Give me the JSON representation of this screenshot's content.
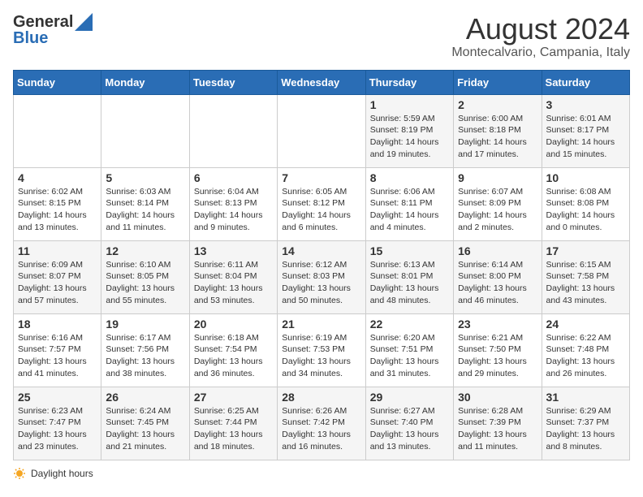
{
  "header": {
    "logo_general": "General",
    "logo_blue": "Blue",
    "title": "August 2024",
    "subtitle": "Montecalvario, Campania, Italy"
  },
  "calendar": {
    "days_of_week": [
      "Sunday",
      "Monday",
      "Tuesday",
      "Wednesday",
      "Thursday",
      "Friday",
      "Saturday"
    ],
    "weeks": [
      [
        {
          "day": "",
          "info": ""
        },
        {
          "day": "",
          "info": ""
        },
        {
          "day": "",
          "info": ""
        },
        {
          "day": "",
          "info": ""
        },
        {
          "day": "1",
          "info": "Sunrise: 5:59 AM\nSunset: 8:19 PM\nDaylight: 14 hours and 19 minutes."
        },
        {
          "day": "2",
          "info": "Sunrise: 6:00 AM\nSunset: 8:18 PM\nDaylight: 14 hours and 17 minutes."
        },
        {
          "day": "3",
          "info": "Sunrise: 6:01 AM\nSunset: 8:17 PM\nDaylight: 14 hours and 15 minutes."
        }
      ],
      [
        {
          "day": "4",
          "info": "Sunrise: 6:02 AM\nSunset: 8:15 PM\nDaylight: 14 hours and 13 minutes."
        },
        {
          "day": "5",
          "info": "Sunrise: 6:03 AM\nSunset: 8:14 PM\nDaylight: 14 hours and 11 minutes."
        },
        {
          "day": "6",
          "info": "Sunrise: 6:04 AM\nSunset: 8:13 PM\nDaylight: 14 hours and 9 minutes."
        },
        {
          "day": "7",
          "info": "Sunrise: 6:05 AM\nSunset: 8:12 PM\nDaylight: 14 hours and 6 minutes."
        },
        {
          "day": "8",
          "info": "Sunrise: 6:06 AM\nSunset: 8:11 PM\nDaylight: 14 hours and 4 minutes."
        },
        {
          "day": "9",
          "info": "Sunrise: 6:07 AM\nSunset: 8:09 PM\nDaylight: 14 hours and 2 minutes."
        },
        {
          "day": "10",
          "info": "Sunrise: 6:08 AM\nSunset: 8:08 PM\nDaylight: 14 hours and 0 minutes."
        }
      ],
      [
        {
          "day": "11",
          "info": "Sunrise: 6:09 AM\nSunset: 8:07 PM\nDaylight: 13 hours and 57 minutes."
        },
        {
          "day": "12",
          "info": "Sunrise: 6:10 AM\nSunset: 8:05 PM\nDaylight: 13 hours and 55 minutes."
        },
        {
          "day": "13",
          "info": "Sunrise: 6:11 AM\nSunset: 8:04 PM\nDaylight: 13 hours and 53 minutes."
        },
        {
          "day": "14",
          "info": "Sunrise: 6:12 AM\nSunset: 8:03 PM\nDaylight: 13 hours and 50 minutes."
        },
        {
          "day": "15",
          "info": "Sunrise: 6:13 AM\nSunset: 8:01 PM\nDaylight: 13 hours and 48 minutes."
        },
        {
          "day": "16",
          "info": "Sunrise: 6:14 AM\nSunset: 8:00 PM\nDaylight: 13 hours and 46 minutes."
        },
        {
          "day": "17",
          "info": "Sunrise: 6:15 AM\nSunset: 7:58 PM\nDaylight: 13 hours and 43 minutes."
        }
      ],
      [
        {
          "day": "18",
          "info": "Sunrise: 6:16 AM\nSunset: 7:57 PM\nDaylight: 13 hours and 41 minutes."
        },
        {
          "day": "19",
          "info": "Sunrise: 6:17 AM\nSunset: 7:56 PM\nDaylight: 13 hours and 38 minutes."
        },
        {
          "day": "20",
          "info": "Sunrise: 6:18 AM\nSunset: 7:54 PM\nDaylight: 13 hours and 36 minutes."
        },
        {
          "day": "21",
          "info": "Sunrise: 6:19 AM\nSunset: 7:53 PM\nDaylight: 13 hours and 34 minutes."
        },
        {
          "day": "22",
          "info": "Sunrise: 6:20 AM\nSunset: 7:51 PM\nDaylight: 13 hours and 31 minutes."
        },
        {
          "day": "23",
          "info": "Sunrise: 6:21 AM\nSunset: 7:50 PM\nDaylight: 13 hours and 29 minutes."
        },
        {
          "day": "24",
          "info": "Sunrise: 6:22 AM\nSunset: 7:48 PM\nDaylight: 13 hours and 26 minutes."
        }
      ],
      [
        {
          "day": "25",
          "info": "Sunrise: 6:23 AM\nSunset: 7:47 PM\nDaylight: 13 hours and 23 minutes."
        },
        {
          "day": "26",
          "info": "Sunrise: 6:24 AM\nSunset: 7:45 PM\nDaylight: 13 hours and 21 minutes."
        },
        {
          "day": "27",
          "info": "Sunrise: 6:25 AM\nSunset: 7:44 PM\nDaylight: 13 hours and 18 minutes."
        },
        {
          "day": "28",
          "info": "Sunrise: 6:26 AM\nSunset: 7:42 PM\nDaylight: 13 hours and 16 minutes."
        },
        {
          "day": "29",
          "info": "Sunrise: 6:27 AM\nSunset: 7:40 PM\nDaylight: 13 hours and 13 minutes."
        },
        {
          "day": "30",
          "info": "Sunrise: 6:28 AM\nSunset: 7:39 PM\nDaylight: 13 hours and 11 minutes."
        },
        {
          "day": "31",
          "info": "Sunrise: 6:29 AM\nSunset: 7:37 PM\nDaylight: 13 hours and 8 minutes."
        }
      ]
    ]
  },
  "footer": {
    "daylight_label": "Daylight hours"
  }
}
